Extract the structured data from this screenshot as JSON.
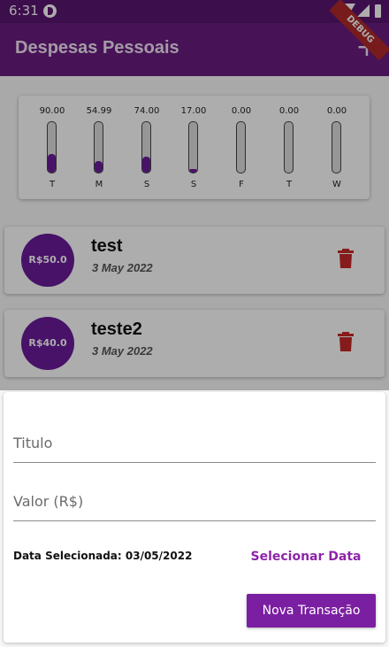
{
  "status_bar": {
    "time": "6:31"
  },
  "app_bar": {
    "title": "Despesas Pessoais",
    "add_icon": "plus-icon"
  },
  "debug_banner": "DEBUG",
  "chart": {
    "bars": [
      {
        "day": "T",
        "value": "90.00",
        "fraction": 0.3763
      },
      {
        "day": "M",
        "value": "54.99",
        "fraction": 0.2299
      },
      {
        "day": "S",
        "value": "74.00",
        "fraction": 0.3094
      },
      {
        "day": "S",
        "value": "17.00",
        "fraction": 0.0711
      },
      {
        "day": "F",
        "value": "0.00",
        "fraction": 0
      },
      {
        "day": "T",
        "value": "0.00",
        "fraction": 0
      },
      {
        "day": "W",
        "value": "0.00",
        "fraction": 0
      }
    ]
  },
  "transactions": [
    {
      "amount": "R$50.0",
      "title": "test",
      "date": "3 May 2022"
    },
    {
      "amount": "R$40.0",
      "title": "teste2",
      "date": "3 May 2022"
    }
  ],
  "form": {
    "title_placeholder": "Titulo",
    "value_placeholder": "Valor (R$)",
    "date_label": "Data Selecionada: 03/05/2022",
    "select_date_label": "Selecionar Data",
    "submit_label": "Nova Transação"
  },
  "colors": {
    "primary": "#6a1b9a",
    "accent": "#8e24aa",
    "delete": "#c62828"
  }
}
